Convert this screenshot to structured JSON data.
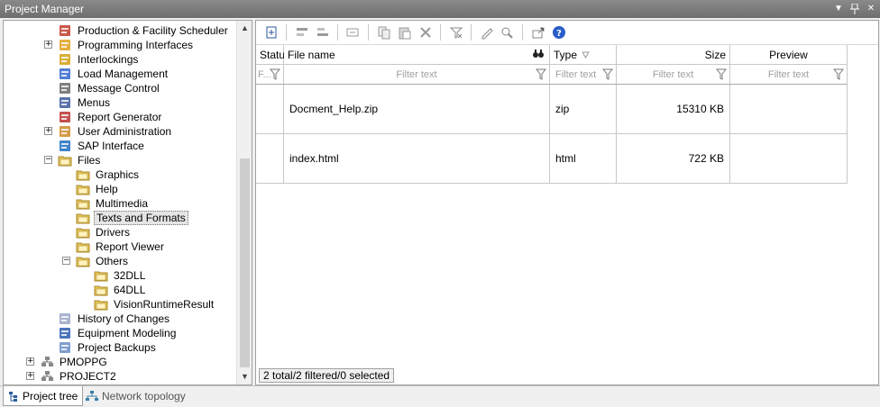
{
  "window": {
    "title": "Project Manager",
    "buttons": [
      "dropdown",
      "pin",
      "close"
    ]
  },
  "tree": {
    "items": [
      {
        "label": "Production & Facility Scheduler",
        "icon": "scheduler-icon",
        "expander": null
      },
      {
        "label": "Programming Interfaces",
        "icon": "gears-icon",
        "expander": "+"
      },
      {
        "label": "Interlockings",
        "icon": "lock-icon",
        "expander": null
      },
      {
        "label": "Load Management",
        "icon": "chart-icon",
        "expander": null
      },
      {
        "label": "Message Control",
        "icon": "phone-icon",
        "expander": null
      },
      {
        "label": "Menus",
        "icon": "menu-icon",
        "expander": null
      },
      {
        "label": "Report Generator",
        "icon": "report-icon",
        "expander": null
      },
      {
        "label": "User Administration",
        "icon": "users-icon",
        "expander": "+"
      },
      {
        "label": "SAP Interface",
        "icon": "sap-icon",
        "expander": null
      },
      {
        "label": "Files",
        "icon": "folder-open-icon",
        "expander": "-"
      },
      {
        "label": "Graphics",
        "icon": "graphics-folder-icon",
        "expander": null
      },
      {
        "label": "Help",
        "icon": "help-folder-icon",
        "expander": null
      },
      {
        "label": "Multimedia",
        "icon": "multimedia-folder-icon",
        "expander": null
      },
      {
        "label": "Texts and Formats",
        "icon": "texts-folder-icon",
        "expander": null,
        "selected": true
      },
      {
        "label": "Drivers",
        "icon": "drivers-folder-icon",
        "expander": null
      },
      {
        "label": "Report Viewer",
        "icon": "report-viewer-folder-icon",
        "expander": null
      },
      {
        "label": "Others",
        "icon": "others-folder-icon",
        "expander": "-"
      },
      {
        "label": "32DLL",
        "icon": "dll-folder-icon",
        "expander": null
      },
      {
        "label": "64DLL",
        "icon": "dll-folder-icon",
        "expander": null
      },
      {
        "label": "VisionRuntimeResult",
        "icon": "dll-folder-icon",
        "expander": null
      },
      {
        "label": "History of Changes",
        "icon": "history-icon",
        "expander": null
      },
      {
        "label": "Equipment Modeling",
        "icon": "equipment-icon",
        "expander": null
      },
      {
        "label": "Project Backups",
        "icon": "backup-icon",
        "expander": null
      },
      {
        "label": "PMOPPG",
        "icon": "project-icon",
        "expander": "+"
      },
      {
        "label": "PROJECT2",
        "icon": "project-icon",
        "expander": "+"
      }
    ]
  },
  "grid": {
    "columns": [
      {
        "label": "Status",
        "filter": "F..."
      },
      {
        "label": "File name",
        "filter": "Filter text"
      },
      {
        "label": "Type",
        "filter": "Filter text"
      },
      {
        "label": "Size",
        "filter": "Filter text"
      },
      {
        "label": "Preview",
        "filter": "Filter text"
      }
    ],
    "rows": [
      {
        "status": "",
        "name": "Docment_Help.zip",
        "type": "zip",
        "size": "15310 KB",
        "preview": ""
      },
      {
        "status": "",
        "name": "index.html",
        "type": "html",
        "size": "722 KB",
        "preview": ""
      }
    ]
  },
  "status": "2 total/2 filtered/0 selected",
  "tabs": [
    {
      "label": "Project tree",
      "active": true
    },
    {
      "label": "Network topology",
      "active": false
    }
  ]
}
